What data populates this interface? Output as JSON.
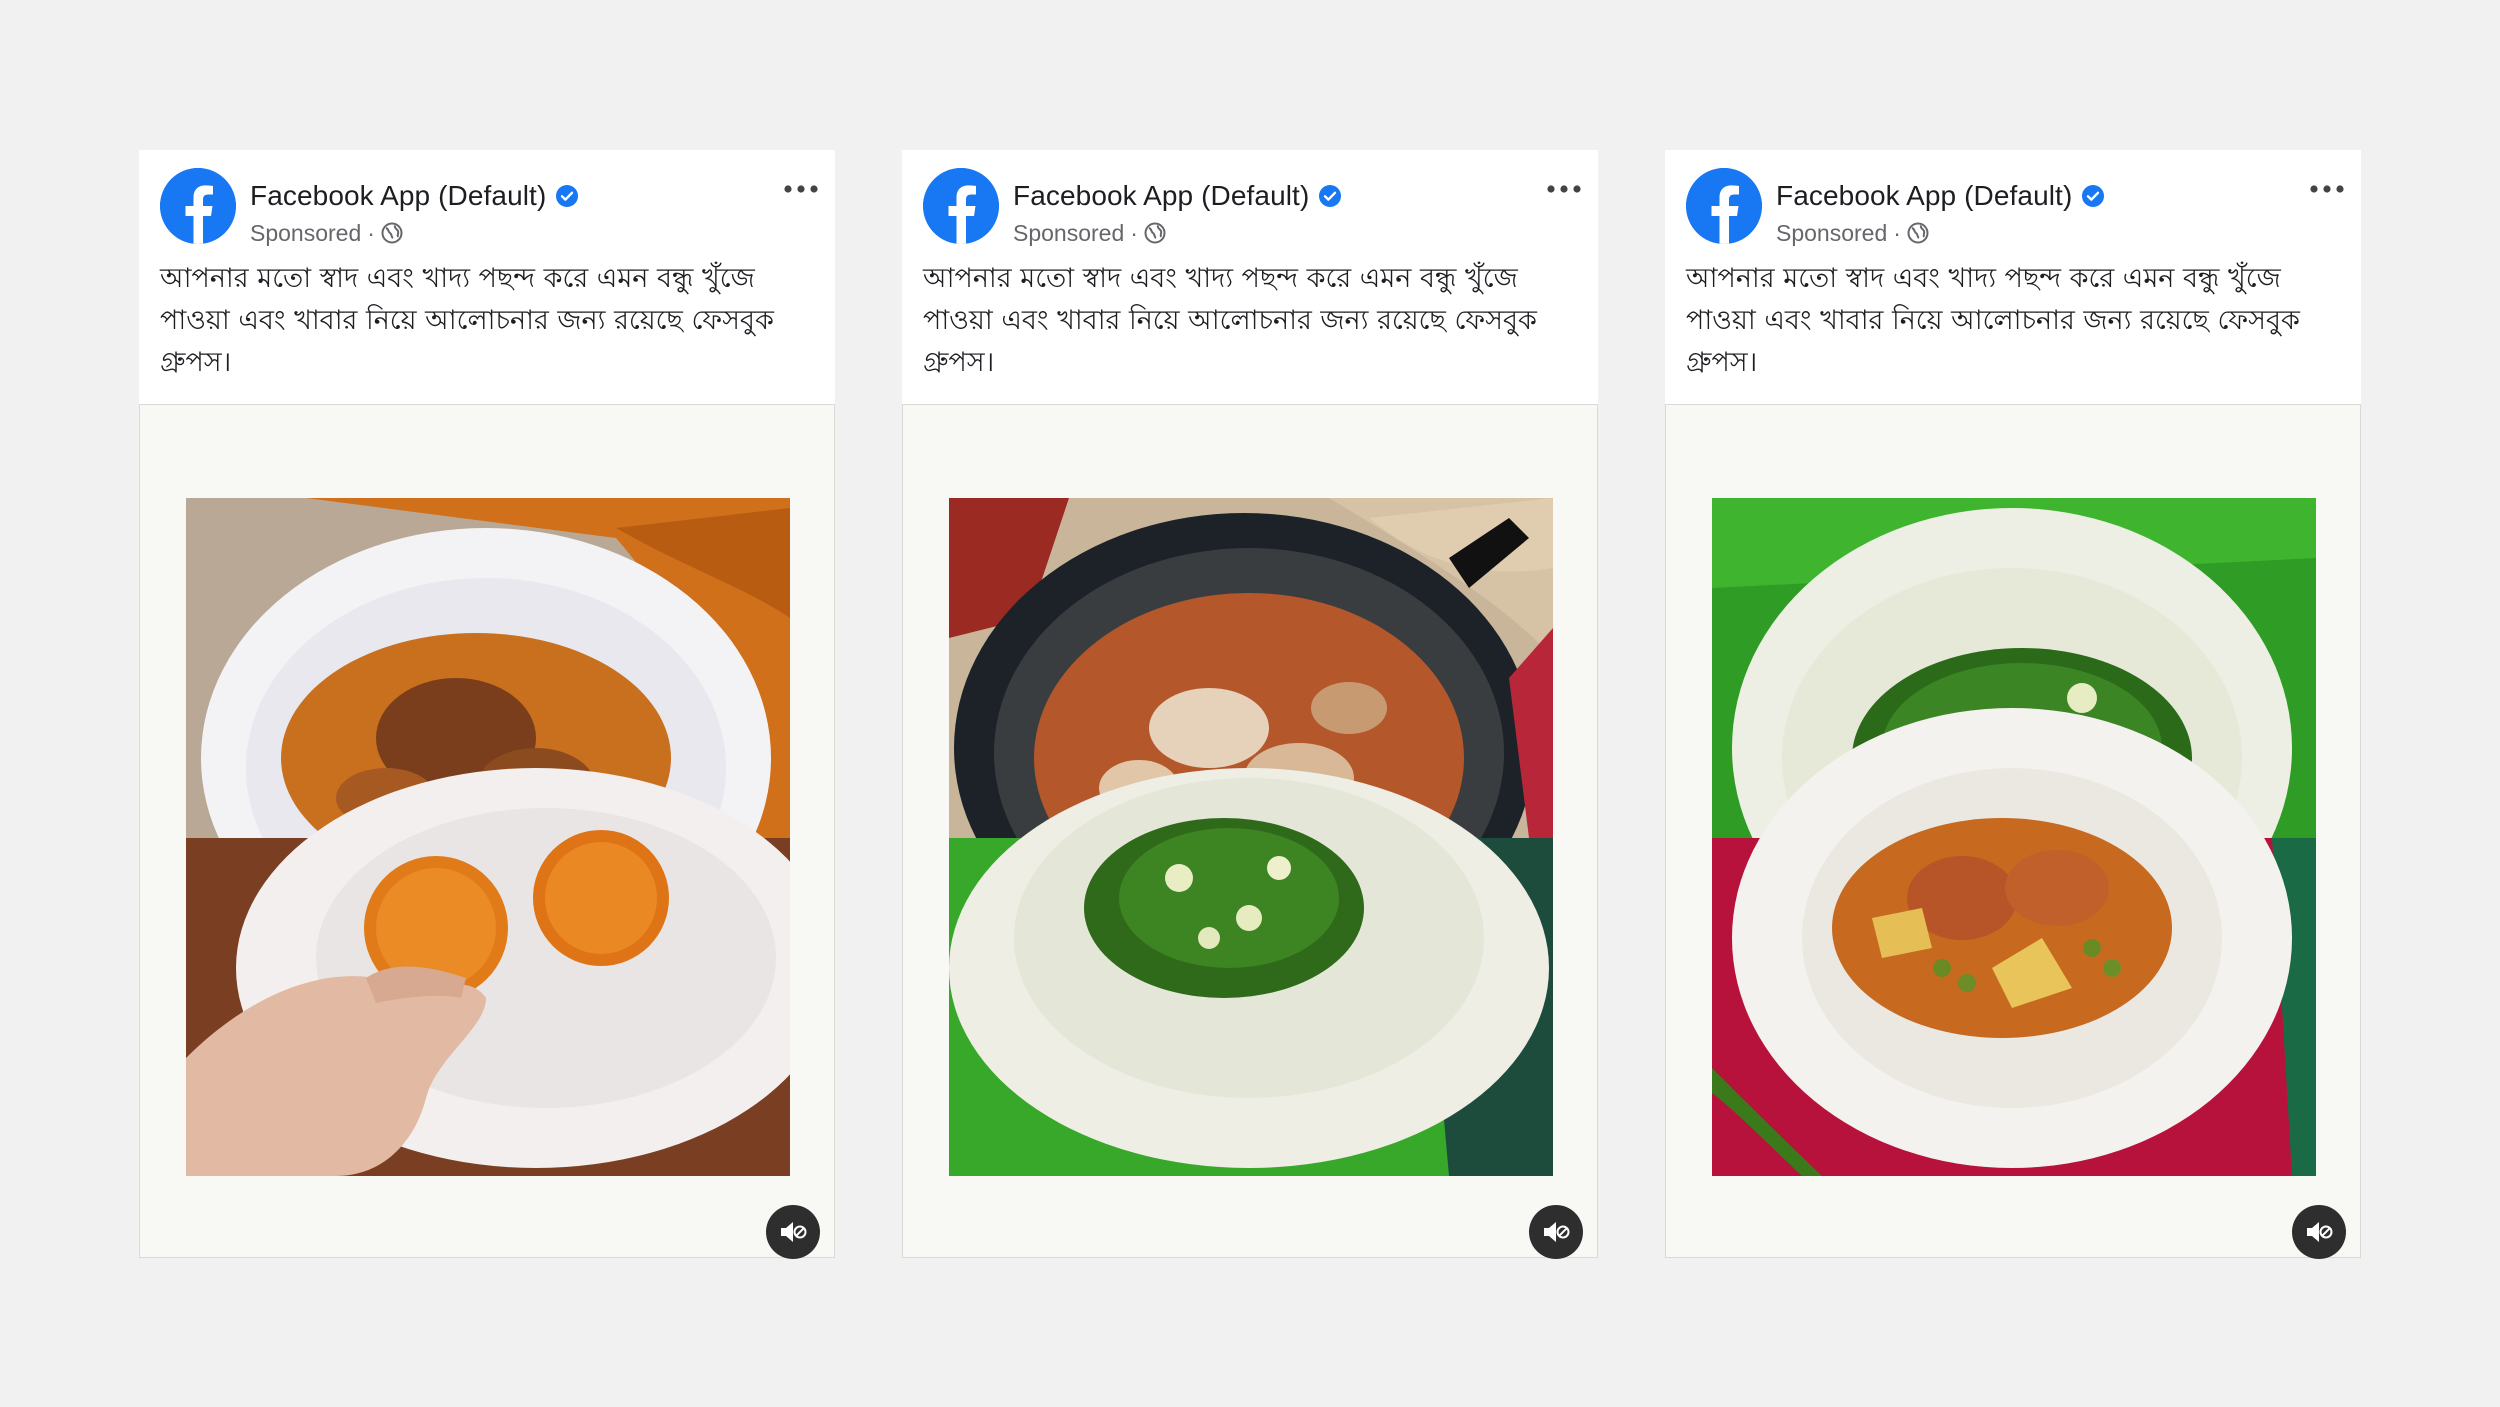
{
  "colors": {
    "background": "#f0f1f0",
    "facebook_blue": "#1877f2",
    "verified_blue": "#1877f2",
    "text_primary": "#1c1e21",
    "text_secondary": "#65676b",
    "media_background": "#f8f8f4"
  },
  "posts": [
    {
      "page_name": "Facebook App (Default)",
      "sponsored_label": "Sponsored",
      "separator": "·",
      "caption": "আপনার মতো স্বাদ এবং খাদ্য পছন্দ করে এমন বন্ধু খুঁজে পাওয়া এবং খাবার নিয়ে আলোচনার জন্য রয়েছে ফেসবুক গ্রুপস।",
      "icons": [
        "facebook-logo-icon",
        "verified-badge-icon",
        "globe-icon",
        "more-options-icon",
        "muted-speaker-icon"
      ],
      "image_top": "orange curry in white plate",
      "image_bottom": "hand holding orange sweet balls"
    },
    {
      "page_name": "Facebook App (Default)",
      "sponsored_label": "Sponsored",
      "separator": "·",
      "caption": "আপনার মতো স্বাদ এবং খাদ্য পছন্দ করে এমন বন্ধু খুঁজে পাওয়া এবং খাবার নিয়ে আলোচনার জন্য রয়েছে ফেসবুক গ্রুপস।",
      "icons": [
        "facebook-logo-icon",
        "verified-badge-icon",
        "globe-icon",
        "more-options-icon",
        "muted-speaker-icon"
      ],
      "image_top": "curry in dark pan",
      "image_bottom": "spinach dish in white plate"
    },
    {
      "page_name": "Facebook App (Default)",
      "sponsored_label": "Sponsored",
      "separator": "·",
      "caption": "আপনার মতো স্বাদ এবং খাদ্য পছন্দ করে এমন বন্ধু খুঁজে পাওয়া এবং খাবার নিয়ে আলোচনার জন্য রয়েছে ফেসবুক গ্রুপস।",
      "icons": [
        "facebook-logo-icon",
        "verified-badge-icon",
        "globe-icon",
        "more-options-icon",
        "muted-speaker-icon"
      ],
      "image_top": "spinach dish on green cloth",
      "image_bottom": "potato and pea curry on red cloth"
    }
  ]
}
